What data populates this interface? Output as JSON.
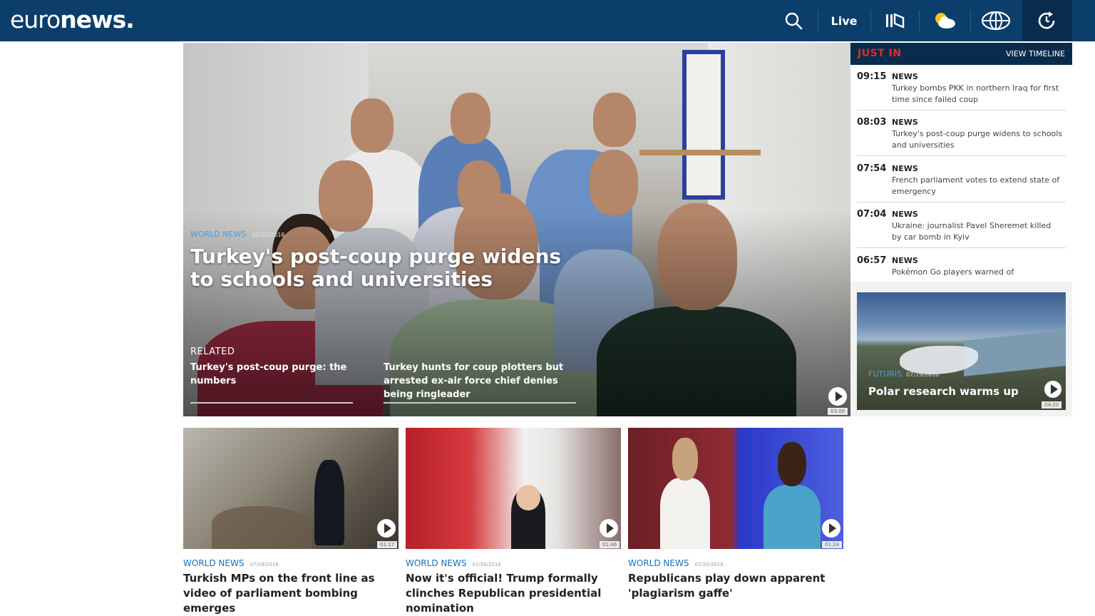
{
  "header": {
    "logo_light": "euro",
    "logo_bold": "news.",
    "nav": {
      "live_label": "Live"
    }
  },
  "hero": {
    "category": "WORLD NEWS",
    "date": "07/20/2016",
    "title": "Turkey's post-coup purge widens to schools and universities",
    "related_label": "RELATED",
    "related": [
      {
        "title": "Turkey's post-coup purge: the numbers"
      },
      {
        "title": "Turkey hunts for coup plotters but arrested ex-air force chief denies being ringleader"
      }
    ],
    "duration": "03:00"
  },
  "just_in": {
    "title": "JUST IN",
    "link": "VIEW TIMELINE",
    "items": [
      {
        "time": "09:15",
        "category": "NEWS",
        "text": "Turkey bombs PKK in northern Iraq for first time since failed coup"
      },
      {
        "time": "08:03",
        "category": "NEWS",
        "text": "Turkey's post-coup purge widens to schools and universities"
      },
      {
        "time": "07:54",
        "category": "NEWS",
        "text": "French parliament votes to extend state of emergency"
      },
      {
        "time": "07:04",
        "category": "NEWS",
        "text": "Ukraine: journalist Pavel Sheremet killed by car bomb in Kyiv"
      },
      {
        "time": "06:57",
        "category": "NEWS",
        "text": "Pokémon Go players warned of"
      }
    ],
    "promo": {
      "category": "FUTURIS",
      "date": "07/19/2016",
      "title": "Polar research warms up",
      "duration": "04:20"
    }
  },
  "cards": [
    {
      "category": "WORLD NEWS",
      "date": "07/19/2016",
      "title": "Turkish MPs on the front line as video of parliament bombing emerges",
      "duration": "01:17"
    },
    {
      "category": "WORLD NEWS",
      "date": "07/20/2016",
      "title": "Now it's official! Trump formally clinches Republican presidential nomination",
      "duration": "01:46"
    },
    {
      "category": "WORLD NEWS",
      "date": "07/20/2016",
      "title": "Republicans play down apparent 'plagiarism gaffe'",
      "duration": "01:24"
    }
  ],
  "colors": {
    "header_bg": "#0b3e6b",
    "just_in_red": "#e02b2b",
    "category_blue": "#1a6fb5"
  }
}
